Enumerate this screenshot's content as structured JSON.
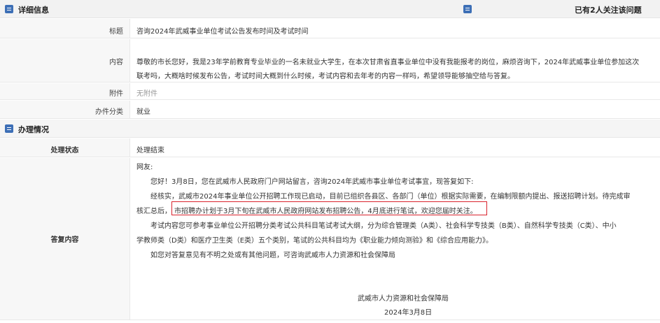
{
  "detail": {
    "header": "详细信息",
    "follow_text": "已有2人关注该问题",
    "fields": {
      "title_label": "标题",
      "title_value": "咨询2024年武威事业单位考试公告发布时间及考试时间",
      "content_label": "内容",
      "content_line1": "尊敬的市长您好，我是23年学前教育专业毕业的一名未就业大学生，在本次甘肃省直事业单位中没有我能报考的岗位，麻烦咨询下，2024年武威事业单位参加这次",
      "content_line2": "联考吗，大概啥时候发布公告，考试时间大概到什么时候，考试内容和去年考的内容一样吗，希望领导能够抽空给与答复。",
      "attachment_label": "附件",
      "attachment_value": "无附件",
      "category_label": "办件分类",
      "category_value": "就业"
    }
  },
  "handling": {
    "header": "办理情况",
    "status_label": "处理状态",
    "status_value": "处理结束",
    "reply_label": "答复内容",
    "reply": {
      "salutation": "网友:",
      "p1": "您好！3月8日，您在武威市人民政府门户网站留言，咨询2024年武威市事业单位考试事宜，现答复如下:",
      "p2_line1": "经核实，武威市2024年事业单位公开招聘工作现已启动，目前已组织各县区、各部门（单位）根据实际需要，在编制限额内提出、报送招聘计划。待完成审",
      "p2_line2a": "核汇总后，",
      "p2_line2b": "市招聘办计划于3月下旬在武威市人民政府网站发布招聘公告，4月底进行笔试，欢迎您届时关注。",
      "p3_line1": "考试内容您可参考事业单位公开招聘分类考试公共科目笔试考试大纲，分为综合管理类（A类）、社会科学专技类（B类）、自然科学专技类（C类）、中小",
      "p3_line2": "学教师类（D类）和医疗卫生类（E类）五个类别，笔试的公共科目均为《职业能力倾向测验》和《综合应用能力》。",
      "p4": "如您对答复意见有不明之处或有其他问题，可咨询武威市人力资源和社会保障局",
      "signature": "武威市人力资源和社会保障局",
      "date": "2024年3月8日"
    }
  }
}
